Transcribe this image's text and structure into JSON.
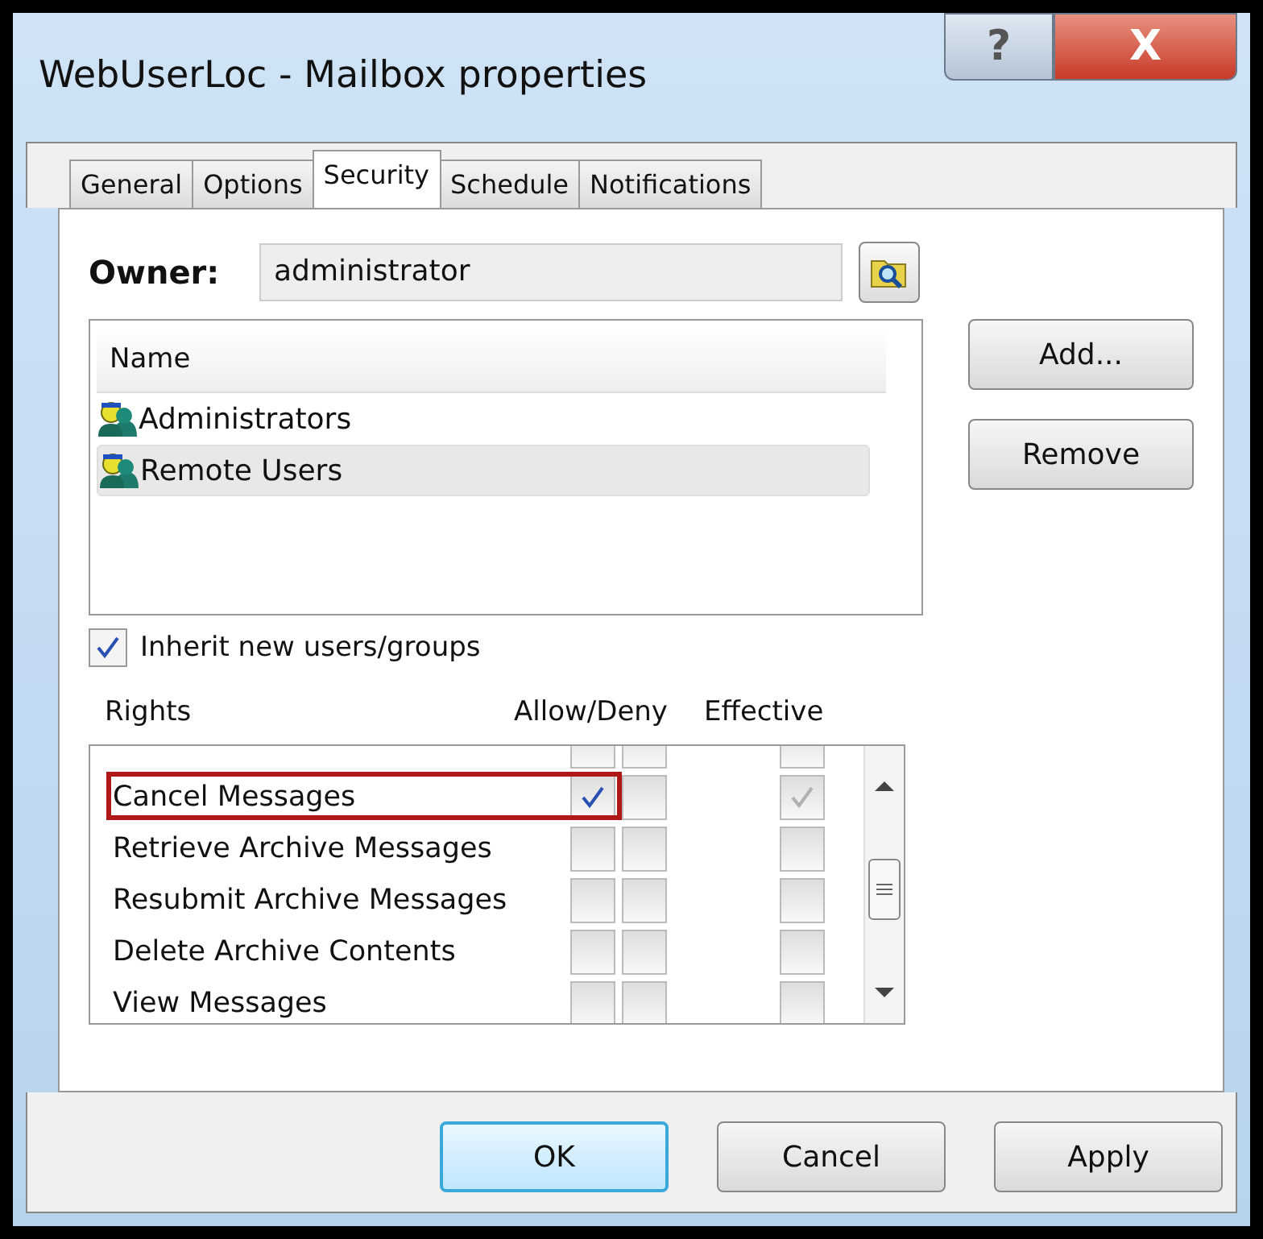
{
  "window": {
    "title": "WebUserLoc - Mailbox properties",
    "help_button": "?",
    "close_button": "X"
  },
  "tabs": [
    {
      "label": "General",
      "selected": false
    },
    {
      "label": "Options",
      "selected": false
    },
    {
      "label": "Security",
      "selected": true
    },
    {
      "label": "Schedule",
      "selected": false
    },
    {
      "label": "Notifications",
      "selected": false
    }
  ],
  "owner": {
    "label": "Owner:",
    "value": "administrator"
  },
  "users_list": {
    "column": "Name",
    "items": [
      {
        "name": "Administrators",
        "selected": false
      },
      {
        "name": "Remote Users",
        "selected": true
      }
    ]
  },
  "side_buttons": [
    "Add...",
    "Remove"
  ],
  "inherit": {
    "label": "Inherit new users/groups",
    "checked": true
  },
  "rights": {
    "columns": [
      "Rights",
      "Allow/Deny",
      "Effective"
    ],
    "row_above": {
      "allow": false,
      "deny": false,
      "effective": false
    },
    "rows": [
      {
        "name": "Cancel Messages",
        "allow": true,
        "deny": false,
        "effective": true,
        "highlighted": true
      },
      {
        "name": "Retrieve Archive Messages",
        "allow": false,
        "deny": false,
        "effective": false,
        "highlighted": false
      },
      {
        "name": "Resubmit Archive Messages",
        "allow": false,
        "deny": false,
        "effective": false,
        "highlighted": false
      },
      {
        "name": "Delete Archive Contents",
        "allow": false,
        "deny": false,
        "effective": false,
        "highlighted": false
      },
      {
        "name": "View Messages",
        "allow": false,
        "deny": false,
        "effective": false,
        "highlighted": false
      }
    ]
  },
  "buttons": [
    {
      "label": "OK",
      "default": true
    },
    {
      "label": "Cancel",
      "default": false
    },
    {
      "label": "Apply",
      "default": false
    }
  ]
}
